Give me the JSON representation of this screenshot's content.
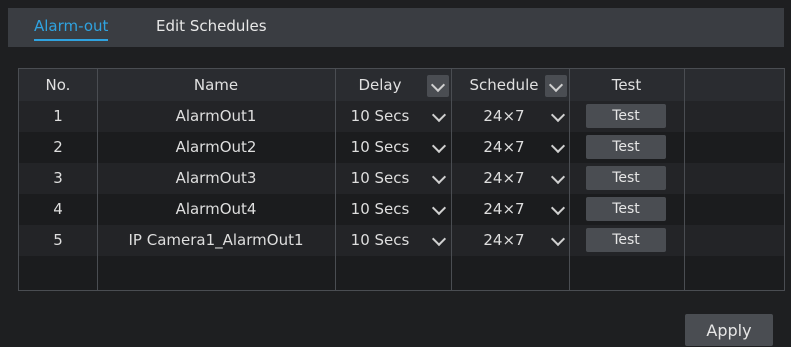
{
  "tabs": [
    {
      "label": "Alarm-out",
      "active": true
    },
    {
      "label": "Edit Schedules",
      "active": false
    }
  ],
  "table": {
    "headers": {
      "no": "No.",
      "name": "Name",
      "delay": "Delay",
      "schedule": "Schedule",
      "test": "Test"
    },
    "rows": [
      {
        "no": "1",
        "name": "AlarmOut1",
        "delay": "10 Secs",
        "schedule": "24×7",
        "test": "Test"
      },
      {
        "no": "2",
        "name": "AlarmOut2",
        "delay": "10 Secs",
        "schedule": "24×7",
        "test": "Test"
      },
      {
        "no": "3",
        "name": "AlarmOut3",
        "delay": "10 Secs",
        "schedule": "24×7",
        "test": "Test"
      },
      {
        "no": "4",
        "name": "AlarmOut4",
        "delay": "10 Secs",
        "schedule": "24×7",
        "test": "Test"
      },
      {
        "no": "5",
        "name": "IP Camera1_AlarmOut1",
        "delay": "10 Secs",
        "schedule": "24×7",
        "test": "Test"
      }
    ]
  },
  "actions": {
    "apply": "Apply"
  },
  "colors": {
    "accent": "#2fa3e0",
    "tabbar": "#3a3d42",
    "background": "#1e1f21",
    "button": "#4a4d52"
  }
}
